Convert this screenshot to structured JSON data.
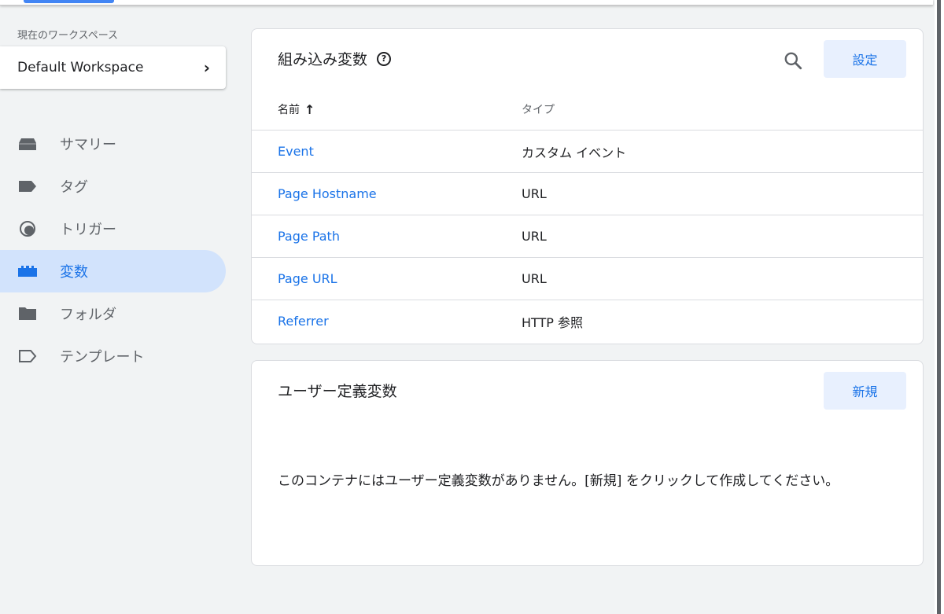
{
  "workspace": {
    "label": "現在のワークスペース",
    "name": "Default Workspace"
  },
  "nav": [
    {
      "label": "サマリー",
      "icon": "summary-icon"
    },
    {
      "label": "タグ",
      "icon": "tag-icon"
    },
    {
      "label": "トリガー",
      "icon": "trigger-icon"
    },
    {
      "label": "変数",
      "icon": "variables-icon",
      "active": true
    },
    {
      "label": "フォルダ",
      "icon": "folder-icon"
    },
    {
      "label": "テンプレート",
      "icon": "template-icon"
    }
  ],
  "builtin": {
    "title": "組み込み変数",
    "help_glyph": "?",
    "settings_label": "設定",
    "col_name": "名前",
    "col_type": "タイプ",
    "rows": [
      {
        "name": "Event",
        "type": "カスタム イベント"
      },
      {
        "name": "Page Hostname",
        "type": "URL"
      },
      {
        "name": "Page Path",
        "type": "URL"
      },
      {
        "name": "Page URL",
        "type": "URL"
      },
      {
        "name": "Referrer",
        "type": "HTTP 参照"
      }
    ]
  },
  "user": {
    "title": "ユーザー定義変数",
    "new_label": "新規",
    "empty_message": "このコンテナにはユーザー定義変数がありません。[新規] をクリックして作成してください。"
  },
  "colors": {
    "accent": "#1a73e8",
    "active_bg": "#d2e3fc",
    "button_bg": "#e8f0fe"
  }
}
